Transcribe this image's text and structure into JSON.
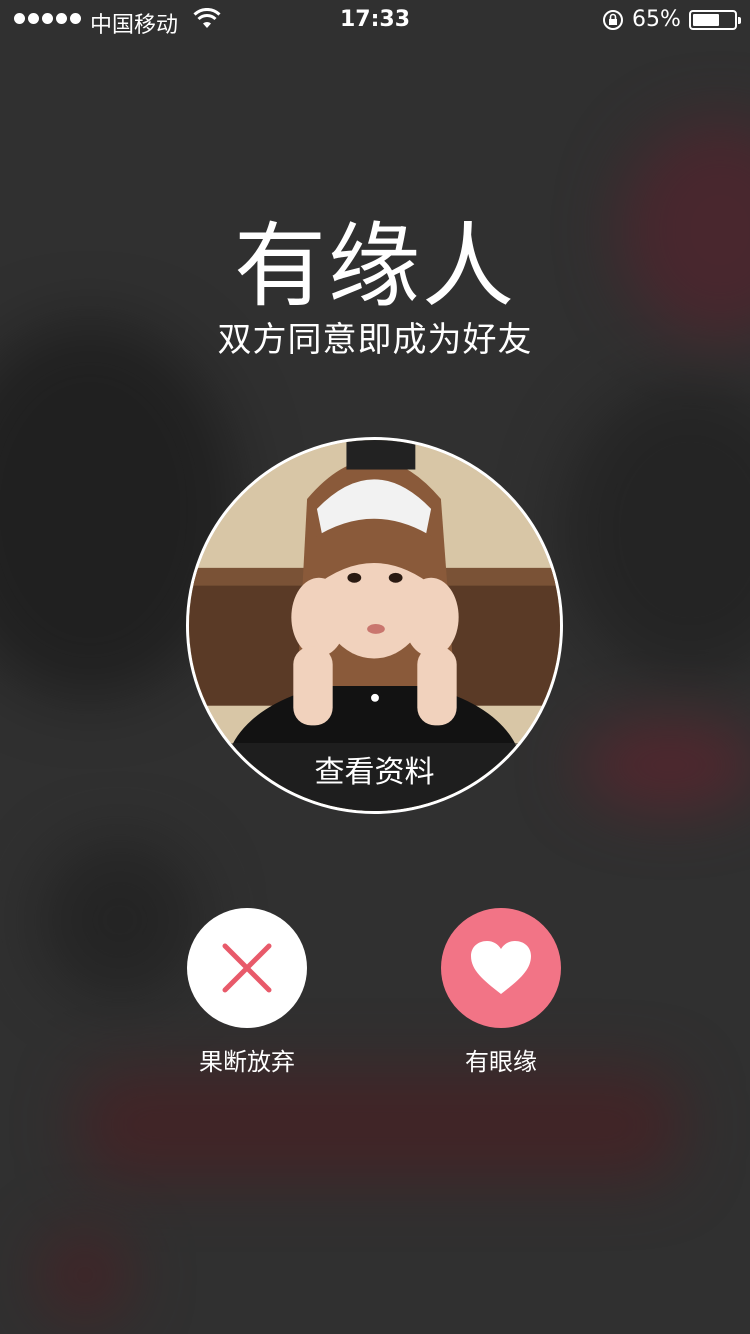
{
  "status_bar": {
    "carrier": "中国移动",
    "time": "17:33",
    "battery_percent_label": "65%",
    "battery_level": 0.65
  },
  "header": {
    "title": "有缘人",
    "subtitle": "双方同意即成为好友"
  },
  "profile": {
    "view_profile_label": "查看资料"
  },
  "actions": {
    "reject_label": "果断放弃",
    "like_label": "有眼缘"
  },
  "colors": {
    "like_button": "#f27486",
    "reject_icon": "#e85a6a",
    "reject_button": "#ffffff"
  },
  "icons": {
    "reject": "close-icon",
    "like": "heart-icon",
    "wifi": "wifi-icon",
    "lock": "rotation-lock-icon"
  }
}
